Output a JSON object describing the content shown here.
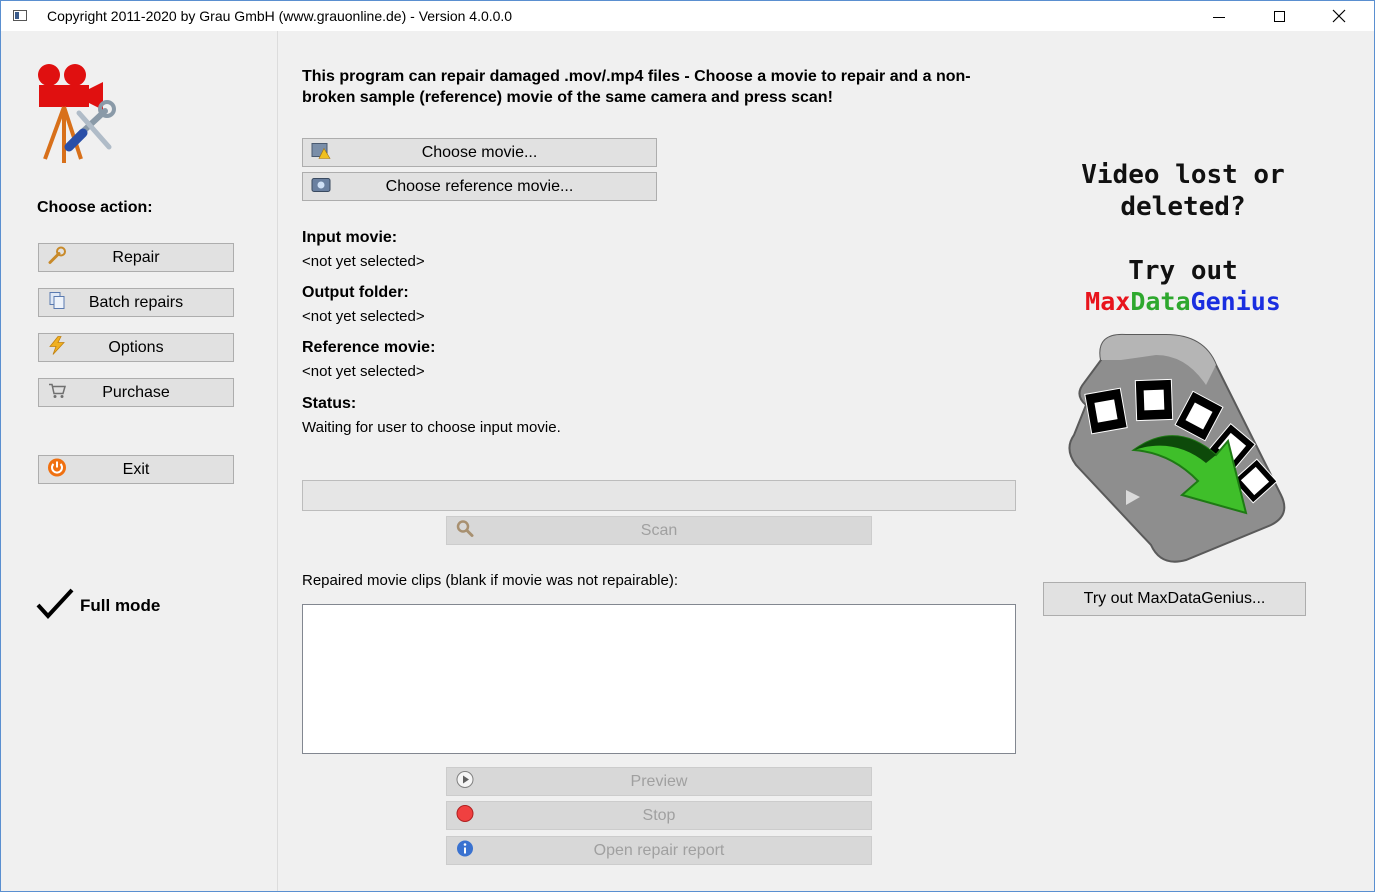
{
  "window": {
    "title": "Copyright 2011-2020 by Grau GmbH (www.grauonline.de) - Version 4.0.0.0"
  },
  "sidebar": {
    "choose_action_label": "Choose action:",
    "buttons": [
      {
        "label": "Repair",
        "icon": "wrench-icon"
      },
      {
        "label": "Batch repairs",
        "icon": "documents-icon"
      },
      {
        "label": "Options",
        "icon": "lightning-icon"
      },
      {
        "label": "Purchase",
        "icon": "cart-icon"
      }
    ],
    "exit_label": "Exit",
    "mode_label": "Full mode"
  },
  "main": {
    "intro_text": "This program can repair damaged .mov/.mp4 files - Choose a movie to repair and a non-broken sample (reference) movie of the same camera and press scan!",
    "choose_movie_label": "Choose movie...",
    "choose_reference_label": "Choose reference movie...",
    "input_movie_heading": "Input movie:",
    "input_movie_value": "<not yet selected>",
    "output_folder_heading": "Output folder:",
    "output_folder_value": "<not yet selected>",
    "reference_movie_heading": "Reference movie:",
    "reference_movie_value": "<not yet selected>",
    "status_heading": "Status:",
    "status_value": "Waiting for user to choose input movie.",
    "progress": 0,
    "scan_label": "Scan",
    "clips_label": "Repaired movie clips (blank if movie was not repairable):",
    "preview_label": "Preview",
    "stop_label": "Stop",
    "report_label": "Open repair report"
  },
  "ad": {
    "line1": "Video lost or",
    "line2": "deleted?",
    "line3": "Try out",
    "brand_part1": "Max",
    "brand_part2": "Data",
    "brand_part3": "Genius",
    "button_label": "Try out MaxDataGenius...",
    "colors": {
      "max": "#e8141c",
      "data": "#2ea82e",
      "genius": "#1a2ee0"
    }
  }
}
